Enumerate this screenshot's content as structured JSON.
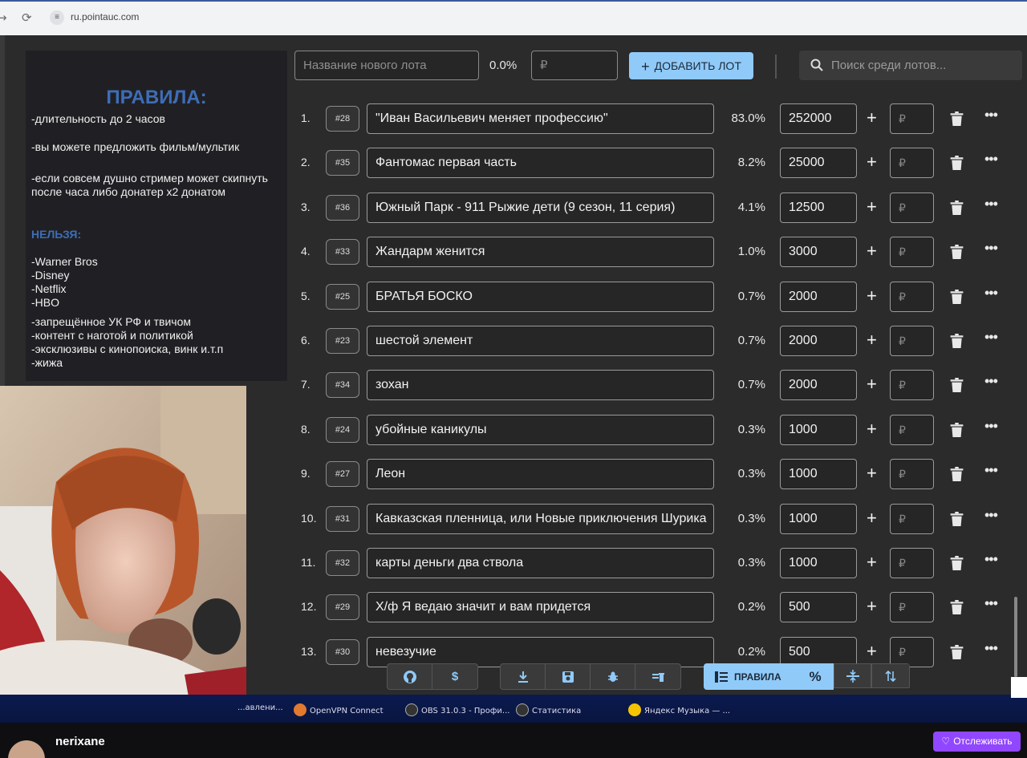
{
  "browser": {
    "url": "ru.pointauc.com"
  },
  "toolbar": {
    "new_lot_placeholder": "Название нового лота",
    "new_lot_percent": "0.0%",
    "amount_placeholder": "₽",
    "add_button_label": "ДОБАВИТЬ ЛОТ",
    "search_placeholder": "Поиск среди лотов..."
  },
  "rules": {
    "title": "ПРАВИЛА:",
    "line1": "-длительность до 2 часов",
    "line2": "-вы можете предложить фильм/мультик",
    "line3": "-если совсем душно стример может скипнуть после часа либо донатер х2 донатом",
    "forbidden_title": "НЕЛЬЗЯ:",
    "forbidden_1": "-Warner Bros",
    "forbidden_2": "-Disney",
    "forbidden_3": "-Netflix",
    "forbidden_4": "-HBO",
    "forbidden_5": "-запрещённое УК РФ и твичом",
    "forbidden_6": "-контент с наготой и политикой",
    "forbidden_7": "-эксклюзивы с кинопоиска, винк и.т.п",
    "forbidden_8": "-жижа"
  },
  "lots": [
    {
      "index": "1.",
      "id": "#28",
      "name": "\"Иван Васильевич меняет профессию\"",
      "percent": "83.0%",
      "amount": "252000"
    },
    {
      "index": "2.",
      "id": "#35",
      "name": "Фантомас первая часть",
      "percent": "8.2%",
      "amount": "25000"
    },
    {
      "index": "3.",
      "id": "#36",
      "name": "Южный Парк - 911 Рыжие дети (9 сезон, 11 серия)",
      "percent": "4.1%",
      "amount": "12500"
    },
    {
      "index": "4.",
      "id": "#33",
      "name": "Жандарм женится",
      "percent": "1.0%",
      "amount": "3000"
    },
    {
      "index": "5.",
      "id": "#25",
      "name": "БРАТЬЯ БОСКО",
      "percent": "0.7%",
      "amount": "2000"
    },
    {
      "index": "6.",
      "id": "#23",
      "name": "шестой элемент",
      "percent": "0.7%",
      "amount": "2000"
    },
    {
      "index": "7.",
      "id": "#34",
      "name": "зохан",
      "percent": "0.7%",
      "amount": "2000"
    },
    {
      "index": "8.",
      "id": "#24",
      "name": "убойные каникулы",
      "percent": "0.3%",
      "amount": "1000"
    },
    {
      "index": "9.",
      "id": "#27",
      "name": "Леон",
      "percent": "0.3%",
      "amount": "1000"
    },
    {
      "index": "10.",
      "id": "#31",
      "name": "Кавказская пленница, или Новые приключения Шурика",
      "percent": "0.3%",
      "amount": "1000"
    },
    {
      "index": "11.",
      "id": "#32",
      "name": "карты деньги два ствола",
      "percent": "0.3%",
      "amount": "1000"
    },
    {
      "index": "12.",
      "id": "#29",
      "name": "Х/ф Я ведаю значит и вам придется",
      "percent": "0.2%",
      "amount": "500"
    },
    {
      "index": "13.",
      "id": "#30",
      "name": "невезучие",
      "percent": "0.2%",
      "amount": "500"
    }
  ],
  "bottom": {
    "rules_label": "ПРАВИЛА",
    "percent_label": "%",
    "dollar_label": "$"
  },
  "taskbar": {
    "item1": "...авлени...",
    "item2": "OpenVPN Connect",
    "item3": "OBS 31.0.3 - Профи...",
    "item4": "Статистика",
    "item5": "Яндекс Музыка — ..."
  },
  "stream": {
    "channel_name": "nerixane",
    "follow_label": "Отслеживать"
  },
  "colors": {
    "accent": "#90caf9",
    "rules_title": "#3e6db6",
    "follow": "#9147ff",
    "background": "#2b2b2b"
  }
}
